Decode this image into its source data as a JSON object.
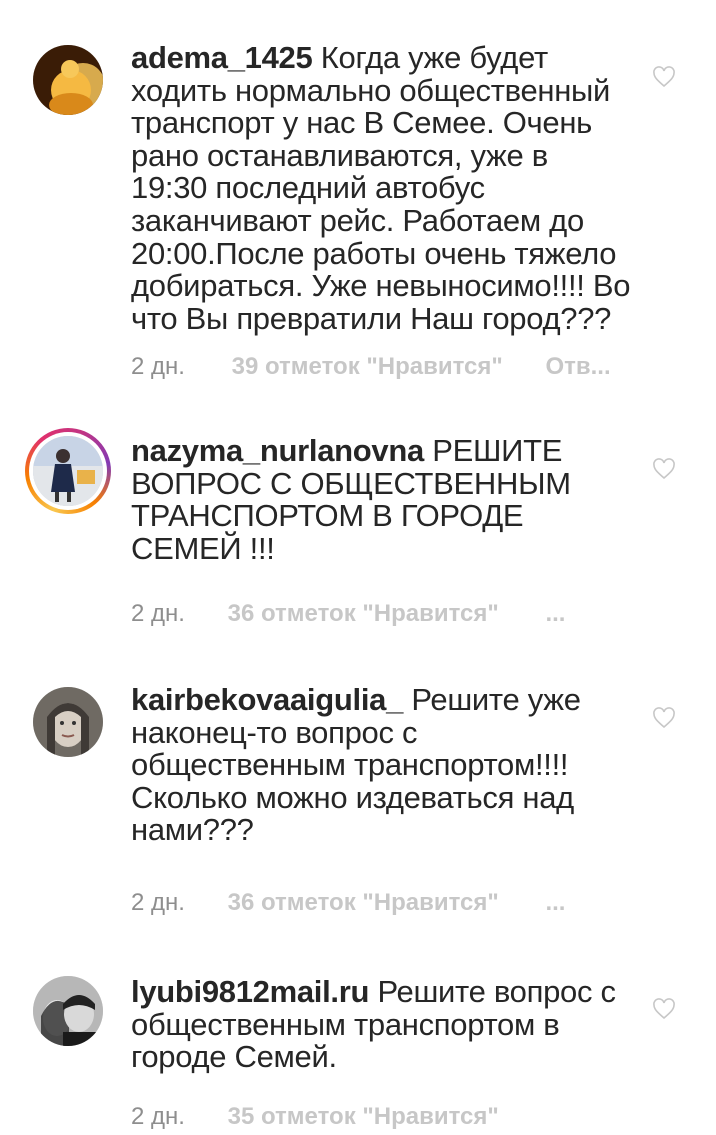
{
  "comments": [
    {
      "username": "adema_1425",
      "text": "Когда уже будет ходить нормально общественный транспорт у нас В Семее. Очень рано останавливаются, уже в 19:30 последний автобус заканчивают рейс. Работаем до 20:00.После работы  очень тяжело добираться. Уже невыносимо!!!! Во что Вы превратили Наш город???",
      "time": "2 дн.",
      "likes": "39 отметок \"Нравится\"",
      "reply": "Отв..."
    },
    {
      "username": "nazyma_nurlanovna",
      "text": "РЕШИТЕ ВОПРОС С ОБЩЕСТВЕННЫМ ТРАНСПОРТОМ В ГОРОДЕ СЕМЕЙ !!!",
      "time": "2 дн.",
      "likes": "36 отметок \"Нравится\"",
      "reply": "..."
    },
    {
      "username": "kairbekovaaigulia_",
      "text": "Решите уже наконец-то вопрос с общественным транспортом!!!! Сколько можно издеваться над нами???",
      "time": "2 дн.",
      "likes": "36 отметок \"Нравится\"",
      "reply": "..."
    },
    {
      "username": "lyubi9812mail.ru",
      "text": "Решите вопрос с общественным транспортом в городе Семей.",
      "time": "2 дн.",
      "likes": "35 отметок \"Нравится\"",
      "reply": ""
    }
  ]
}
